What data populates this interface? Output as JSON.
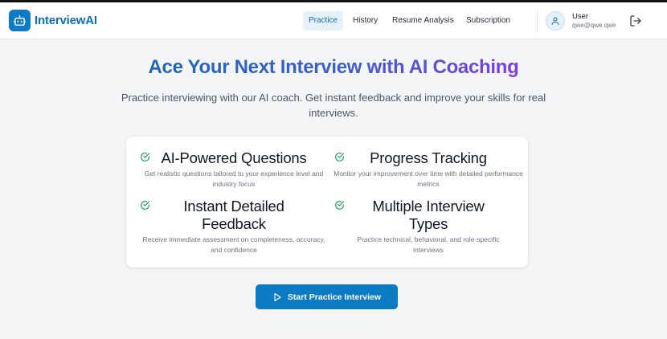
{
  "brand": {
    "name": "InterviewAI",
    "color": "#0d7ac4"
  },
  "nav": {
    "items": [
      {
        "label": "Practice",
        "active": true
      },
      {
        "label": "History",
        "active": false
      },
      {
        "label": "Resume Analysis",
        "active": false
      },
      {
        "label": "Subscription",
        "active": false
      }
    ]
  },
  "user": {
    "name": "User",
    "email": "qwe@qwe.qwe"
  },
  "hero": {
    "title": "Ace Your Next Interview with AI Coaching",
    "subtitle": "Practice interviewing with our AI coach. Get instant feedback and improve your skills for real interviews."
  },
  "features": [
    {
      "title": "AI-Powered Questions",
      "description": "Get realistic questions tailored to your experience level and industry focus",
      "icon": "check-circle-icon"
    },
    {
      "title": "Progress Tracking",
      "description": "Monitor your improvement over time with detailed performance metrics",
      "icon": "check-circle-icon"
    },
    {
      "title": "Instant Detailed Feedback",
      "description": "Receive immediate assessment on completeness, accuracy, and confidence",
      "icon": "check-circle-icon"
    },
    {
      "title": "Multiple Interview Types",
      "description": "Practice technical, behavioral, and role-specific interviews",
      "icon": "check-circle-icon"
    }
  ],
  "cta": {
    "label": "Start Practice Interview",
    "icon": "play-icon"
  },
  "colors": {
    "accent": "#0d7ac4",
    "check": "#22a35a",
    "gradient_start": "#1f66b8",
    "gradient_end": "#7c3fe0"
  }
}
